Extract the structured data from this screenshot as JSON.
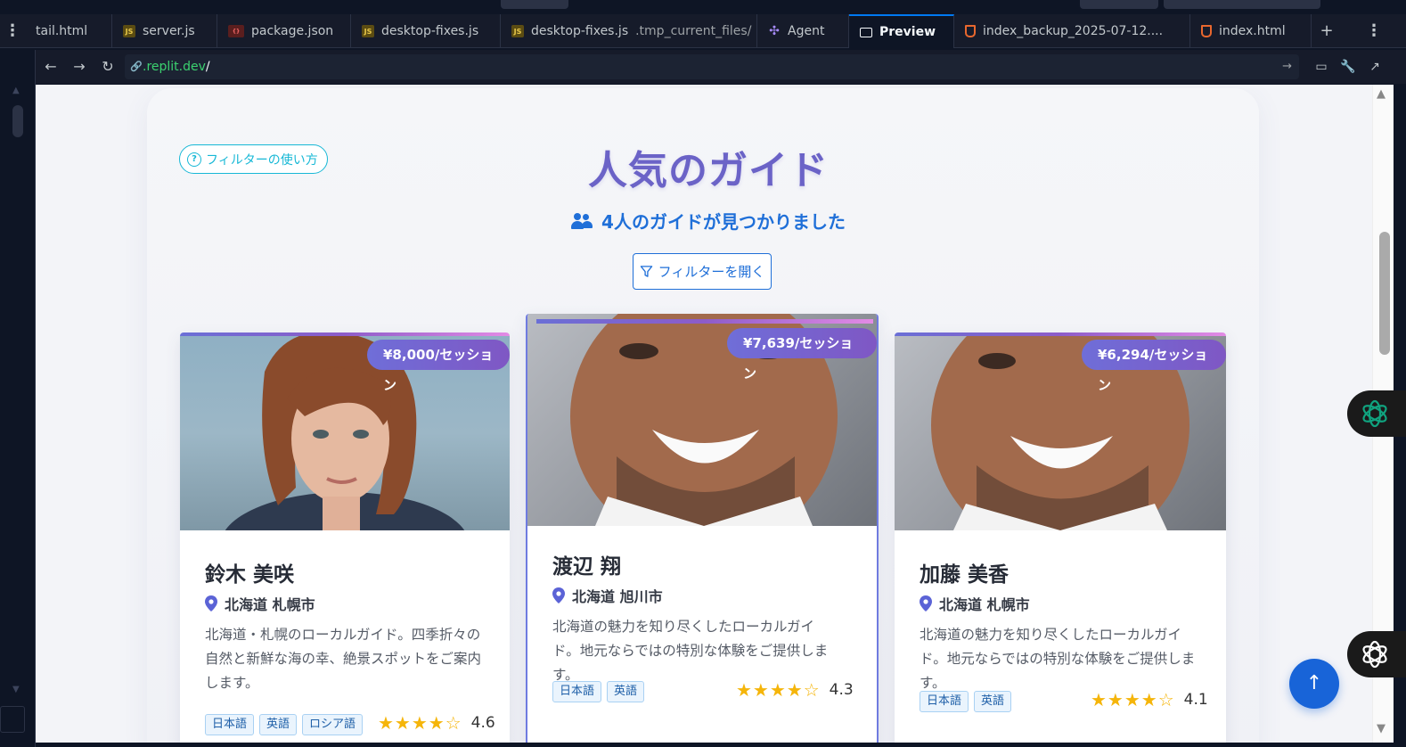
{
  "tabs": [
    {
      "label": "tail.html",
      "type": "html"
    },
    {
      "label": "server.js",
      "type": "js"
    },
    {
      "label": "package.json",
      "type": "json"
    },
    {
      "label": "desktop-fixes.js",
      "type": "js"
    },
    {
      "label": "desktop-fixes.js",
      "sub": ".tmp_current_files/",
      "type": "js"
    },
    {
      "label": "Agent",
      "type": "agent"
    },
    {
      "label": "Preview",
      "type": "preview",
      "active": true
    },
    {
      "label": "index_backup_2025-07-12....",
      "type": "html"
    },
    {
      "label": "index.html",
      "type": "html"
    }
  ],
  "url": {
    "domain": ".replit.dev",
    "path": "/"
  },
  "page": {
    "help_label": "フィルターの使い方",
    "title": "人気のガイド",
    "found_text": "4人のガイドが見つかりました",
    "filter_label": "フィルターを開く"
  },
  "guides": [
    {
      "name": "鈴木 美咲",
      "location": "北海道 札幌市",
      "price": "¥8,000/セッション",
      "description": "北海道・札幌のローカルガイド。四季折々の自然と新鮮な海の幸、絶景スポットをご案内します。",
      "languages": [
        "日本語",
        "英語",
        "ロシア語"
      ],
      "stars": "★★★★☆",
      "rating": "4.6"
    },
    {
      "name": "渡辺 翔",
      "location": "北海道 旭川市",
      "price": "¥7,639/セッション",
      "description": "北海道の魅力を知り尽くしたローカルガイド。地元ならではの特別な体験をご提供します。",
      "languages": [
        "日本語",
        "英語"
      ],
      "stars": "★★★★☆",
      "rating": "4.3"
    },
    {
      "name": "加藤 美香",
      "location": "北海道 札幌市",
      "price": "¥6,294/セッション",
      "description": "北海道の魅力を知り尽くしたローカルガイド。地元ならではの特別な体験をご提供します。",
      "languages": [
        "日本語",
        "英語"
      ],
      "stars": "★★★★☆",
      "rating": "4.1"
    }
  ],
  "colors": {
    "accent": "#1f6fd8",
    "title": "#6b63c7",
    "help": "#17b8d6",
    "star": "#f5b50a",
    "price_gradient": [
      "#6f6ed8",
      "#7f57c4"
    ]
  },
  "icons": {
    "help": "question-circle-icon",
    "users": "users-icon",
    "filter": "funnel-icon",
    "location": "map-pin-icon",
    "scroll_top": "arrow-up-icon",
    "assistant": "openai-logo-icon"
  }
}
